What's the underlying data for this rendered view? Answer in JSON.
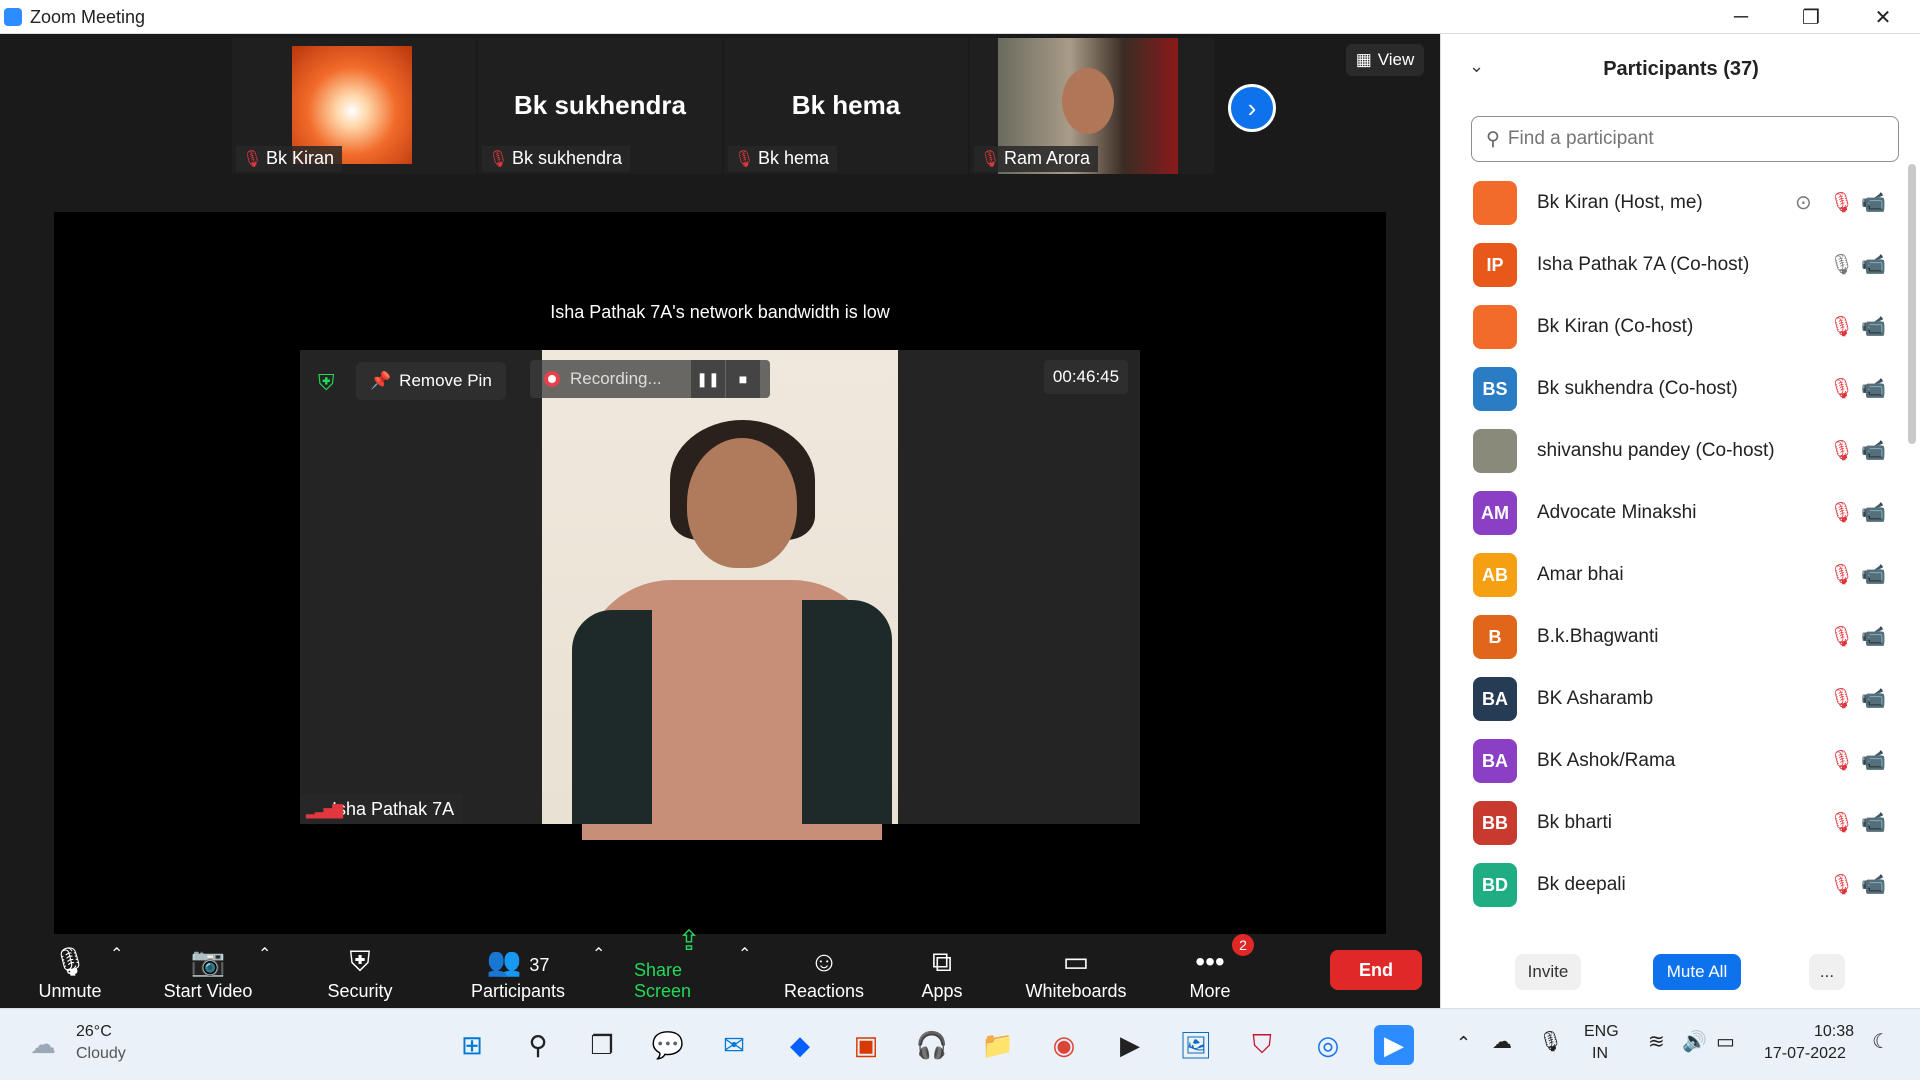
{
  "window": {
    "title": "Zoom Meeting",
    "minimize": "─",
    "restore": "❐",
    "close": "✕"
  },
  "thumbnails": [
    {
      "name": "Bk Kiran",
      "display_name": ""
    },
    {
      "name": "Bk sukhendra",
      "display_name": "Bk sukhendra"
    },
    {
      "name": "Bk hema",
      "display_name": "Bk hema"
    },
    {
      "name": "Ram Arora",
      "display_name": ""
    }
  ],
  "view_button": "View",
  "stage": {
    "notice": "Isha Pathak 7A's network bandwidth is low",
    "remove_pin": "Remove Pin",
    "recording": "Recording...",
    "timer": "00:46:45",
    "pinned_name": "Isha Pathak 7A"
  },
  "toolbar": {
    "unmute": "Unmute",
    "start_video": "Start Video",
    "security": "Security",
    "participants": "Participants",
    "participants_count": "37",
    "share_screen": "Share Screen",
    "reactions": "Reactions",
    "apps": "Apps",
    "whiteboards": "Whiteboards",
    "more": "More",
    "more_badge": "2",
    "end": "End"
  },
  "panel": {
    "title": "Participants (37)",
    "search_placeholder": "Find a participant",
    "participants": [
      {
        "initials": "",
        "name": "Bk Kiran (Host, me)",
        "color": "#f26b2a"
      },
      {
        "initials": "IP",
        "name": "Isha Pathak 7A (Co-host)",
        "color": "#e8581a"
      },
      {
        "initials": "",
        "name": "Bk Kiran (Co-host)",
        "color": "#f26b2a"
      },
      {
        "initials": "BS",
        "name": "Bk sukhendra (Co-host)",
        "color": "#2a7dc4"
      },
      {
        "initials": "",
        "name": "shivanshu pandey (Co-host)",
        "color": "#8a8a7a"
      },
      {
        "initials": "AM",
        "name": "Advocate Minakshi",
        "color": "#8a3fc4"
      },
      {
        "initials": "AB",
        "name": "Amar bhai",
        "color": "#f5a012"
      },
      {
        "initials": "B",
        "name": "B.k.Bhagwanti",
        "color": "#e0661a"
      },
      {
        "initials": "BA",
        "name": "BK Asharamb",
        "color": "#263c55"
      },
      {
        "initials": "BA",
        "name": "BK Ashok/Rama",
        "color": "#8a3fc4"
      },
      {
        "initials": "BB",
        "name": "Bk bharti",
        "color": "#c83a2e"
      },
      {
        "initials": "BD",
        "name": "Bk deepali",
        "color": "#1fae84"
      }
    ],
    "invite": "Invite",
    "mute_all": "Mute All",
    "more": "..."
  },
  "taskbar": {
    "weather_temp": "26°C",
    "weather_desc": "Cloudy",
    "lang_1": "ENG",
    "lang_2": "IN",
    "time": "10:38",
    "date": "17-07-2022"
  }
}
